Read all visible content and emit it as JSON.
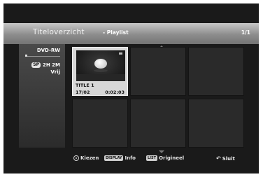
{
  "header": {
    "title": "Titeloverzicht",
    "subtitle": "- Playlist",
    "page": "1/1"
  },
  "sidebar": {
    "disc": "DVD-RW",
    "mode_badge": "SP",
    "remaining": "2H 2M",
    "free_label": "Vrij"
  },
  "titles": [
    {
      "name": "TITLE 1",
      "date": "17/02",
      "duration": "0:02:03",
      "selected": true
    }
  ],
  "footer": {
    "select_label": "Kiezen",
    "display_key": "DISPLAY",
    "info_label": "Info",
    "list_key": "LIST",
    "original_label": "Origineel",
    "close_label": "Sluit"
  },
  "colors": {
    "header_gradient_top": "#c7c7c7",
    "header_gradient_bottom": "#747474",
    "background": "#1a1a1a",
    "selected_cell": "#d7d7d7",
    "empty_cell": "#2a2a2a"
  }
}
